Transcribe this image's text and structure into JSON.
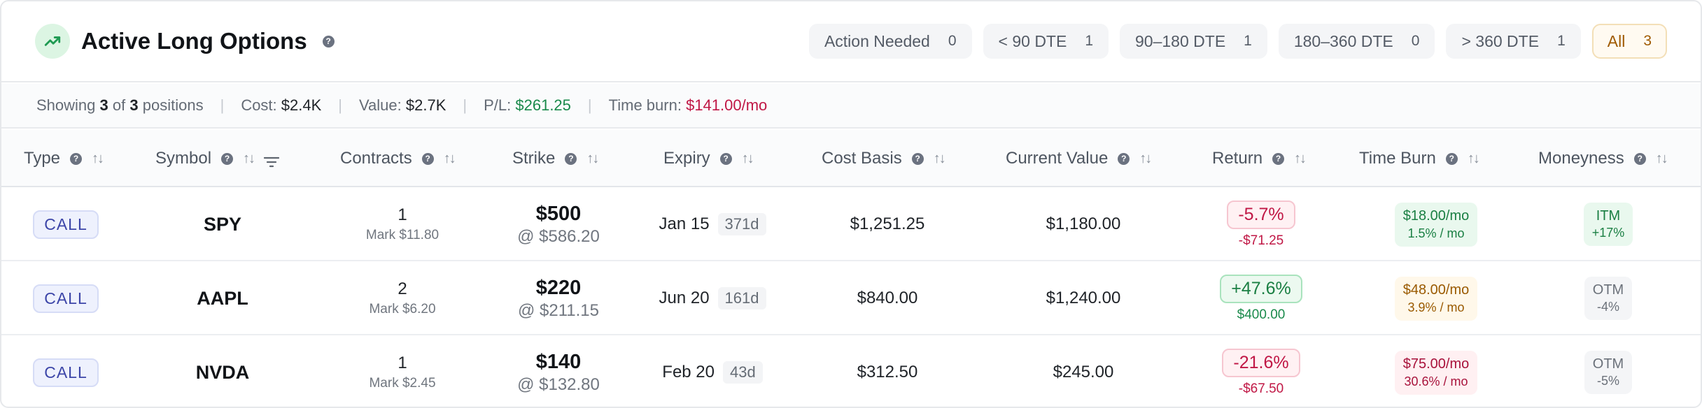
{
  "header": {
    "title": "Active Long Options",
    "filters": [
      {
        "label": "Action Needed",
        "count": "0"
      },
      {
        "label": "< 90 DTE",
        "count": "1"
      },
      {
        "label": "90–180 DTE",
        "count": "1"
      },
      {
        "label": "180–360 DTE",
        "count": "0"
      },
      {
        "label": "> 360 DTE",
        "count": "1"
      },
      {
        "label": "All",
        "count": "3"
      }
    ]
  },
  "summary": {
    "showing_prefix": "Showing",
    "shown": "3",
    "of_text": "of",
    "total": "3",
    "positions_text": "positions",
    "cost_label": "Cost:",
    "cost_value": "$2.4K",
    "value_label": "Value:",
    "value_value": "$2.7K",
    "pl_label": "P/L:",
    "pl_value": "$261.25",
    "burn_label": "Time burn:",
    "burn_value": "$141.00/mo"
  },
  "columns": {
    "type": "Type",
    "symbol": "Symbol",
    "contracts": "Contracts",
    "strike": "Strike",
    "expiry": "Expiry",
    "cost_basis": "Cost Basis",
    "current_value": "Current Value",
    "return": "Return",
    "time_burn": "Time Burn",
    "moneyness": "Moneyness"
  },
  "rows": [
    {
      "type": "CALL",
      "symbol": "SPY",
      "contracts": "1",
      "mark": "Mark $11.80",
      "strike": "$500",
      "strike_at": "@ $586.20",
      "expiry": "Jan 15",
      "dte": "371d",
      "cost_basis": "$1,251.25",
      "current_value": "$1,180.00",
      "return_pct": "-5.7%",
      "return_amt": "-$71.25",
      "burn": "$18.00/mo",
      "burn_pct": "1.5% / mo",
      "moneyness": "ITM",
      "moneyness_pct": "+17%"
    },
    {
      "type": "CALL",
      "symbol": "AAPL",
      "contracts": "2",
      "mark": "Mark $6.20",
      "strike": "$220",
      "strike_at": "@ $211.15",
      "expiry": "Jun 20",
      "dte": "161d",
      "cost_basis": "$840.00",
      "current_value": "$1,240.00",
      "return_pct": "+47.6%",
      "return_amt": "$400.00",
      "burn": "$48.00/mo",
      "burn_pct": "3.9% / mo",
      "moneyness": "OTM",
      "moneyness_pct": "-4%"
    },
    {
      "type": "CALL",
      "symbol": "NVDA",
      "contracts": "1",
      "mark": "Mark $2.45",
      "strike": "$140",
      "strike_at": "@ $132.80",
      "expiry": "Feb 20",
      "dte": "43d",
      "cost_basis": "$312.50",
      "current_value": "$245.00",
      "return_pct": "-21.6%",
      "return_amt": "-$67.50",
      "burn": "$75.00/mo",
      "burn_pct": "30.6% / mo",
      "moneyness": "OTM",
      "moneyness_pct": "-5%"
    }
  ],
  "colors": {
    "positive": "#1a8a4b",
    "negative": "#c01745",
    "accent_active_filter": "#a05a00",
    "call_badge": "#3c45a8"
  }
}
